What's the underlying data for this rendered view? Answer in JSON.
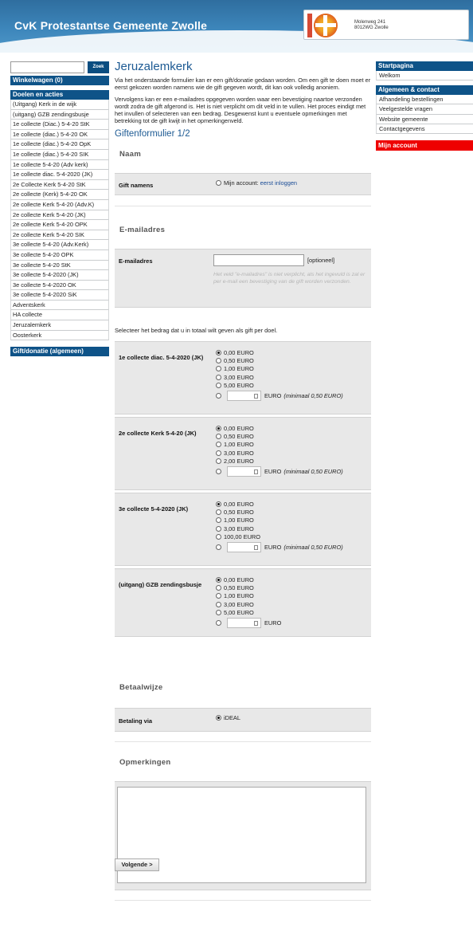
{
  "header": {
    "site_title": "CvK Protestantse Gemeente Zwolle",
    "address_line1": "Molenweg 241",
    "address_line2": "8012WG Zwolle"
  },
  "left": {
    "search_button": "Zoek",
    "cart": "Winkelwagen (0)",
    "goals_heading": "Doelen en acties",
    "items": [
      "(Uitgang) Kerk in de wijk",
      "(uitgang) GZB zendingsbusje",
      "1e collecte (Diac.) 5-4-20 StK",
      "1e collecte (diac.) 5-4-20 OK",
      "1e collecte (diac.) 5-4-20 OpK",
      "1e collecte (diac.) 5-4-20 SIK",
      "1e collecte 5-4-20 (Adv kerk)",
      "1e collecte diac. 5-4-2020 (JK)",
      "2e Collecte Kerk 5-4-20 StK",
      "2e collecte (Kerk) 5-4-20 OK",
      "2e collecte Kerk 5-4-20 (Adv.K)",
      "2e collecte Kerk 5-4-20 (JK)",
      "2e collecte Kerk 5-4-20 OPK",
      "2e collecte Kerk 5-4-20 SIK",
      "3e collecte 5-4-20 (Adv.Kerk)",
      "3e collecte 5-4-20 OPK",
      "3e collecte 5-4-20 StK",
      "3e collecte 5-4-2020 (JK)",
      "3e collecte 5-4-2020 OK",
      "3e collecte 5-4-2020 SiK",
      "Adventskerk",
      "HA collecte",
      "Jeruzalemkerk",
      "Oosterkerk"
    ],
    "gift_general": "Gift/donatie (algemeen)"
  },
  "right": {
    "group1_heading": "Startpagina",
    "group1_items": [
      "Welkom"
    ],
    "group2_heading": "Algemeen & contact",
    "group2_items": [
      "Afhandeling bestellingen",
      "Veelgestelde vragen",
      "Website gemeente",
      "Contactgegevens"
    ],
    "my_account": "Mijn account"
  },
  "main": {
    "title": "Jeruzalemkerk",
    "intro1": "Via het onderstaande formulier kan er een gift/donatie gedaan worden. Om een gift te doen moet er eerst gekozen worden namens wie de gift gegeven wordt, dit kan ook volledig anoniem.",
    "intro2": "Vervolgens kan er een e-mailadres opgegeven worden waar een bevestiging naartoe verzonden wordt zodra de gift afgerond is. Het is niet verplicht om dit veld in te vullen. Het proces eindigt met het invullen of selecteren van een bedrag. Desgewenst kunt u eventuele opmerkingen met betrekking tot de gift kwijt in het opmerkingenveld.",
    "form_title": "Giftenformulier 1/2",
    "naam": {
      "section": "Naam",
      "label": "Gift namens",
      "option": "Mijn account:",
      "link": "eerst inloggen"
    },
    "email": {
      "section": "E-mailadres",
      "label": "E-mailadres",
      "optional": "[optioneel]",
      "help": "Het veld \"e-mailadres\" is niet verplicht, als het ingevuld is zal er per e-mail een bevestiging van de gift worden verzonden."
    },
    "amount_instruction": "Selecteer het bedrag dat u in totaal wilt geven als gift per doel.",
    "goals": [
      {
        "label": "1e collecte diac. 5-4-2020 (JK)",
        "options": [
          "0,00 EURO",
          "0,50 EURO",
          "1,00 EURO",
          "3,00 EURO",
          "5,00 EURO"
        ]
      },
      {
        "label": "2e collecte Kerk 5-4-20 (JK)",
        "options": [
          "0,00 EURO",
          "0,50 EURO",
          "1,00 EURO",
          "3,00 EURO",
          "2,00 EURO"
        ]
      },
      {
        "label": "3e collecte 5-4-2020 (JK)",
        "options": [
          "0,00 EURO",
          "0,50 EURO",
          "1,00 EURO",
          "3,00 EURO",
          "100,00 EURO"
        ]
      },
      {
        "label": "(uitgang) GZB zendingsbusje",
        "options": [
          "0,00 EURO",
          "0,50 EURO",
          "1,00 EURO",
          "3,00 EURO",
          "5,00 EURO"
        ]
      }
    ],
    "custom_euro": "EURO",
    "custom_min": "(minimaal 0,50 EURO)",
    "payment": {
      "section": "Betaalwijze",
      "label": "Betaling via",
      "option": "iDEAL"
    },
    "comments_section": "Opmerkingen",
    "next_button": "Volgende >"
  }
}
